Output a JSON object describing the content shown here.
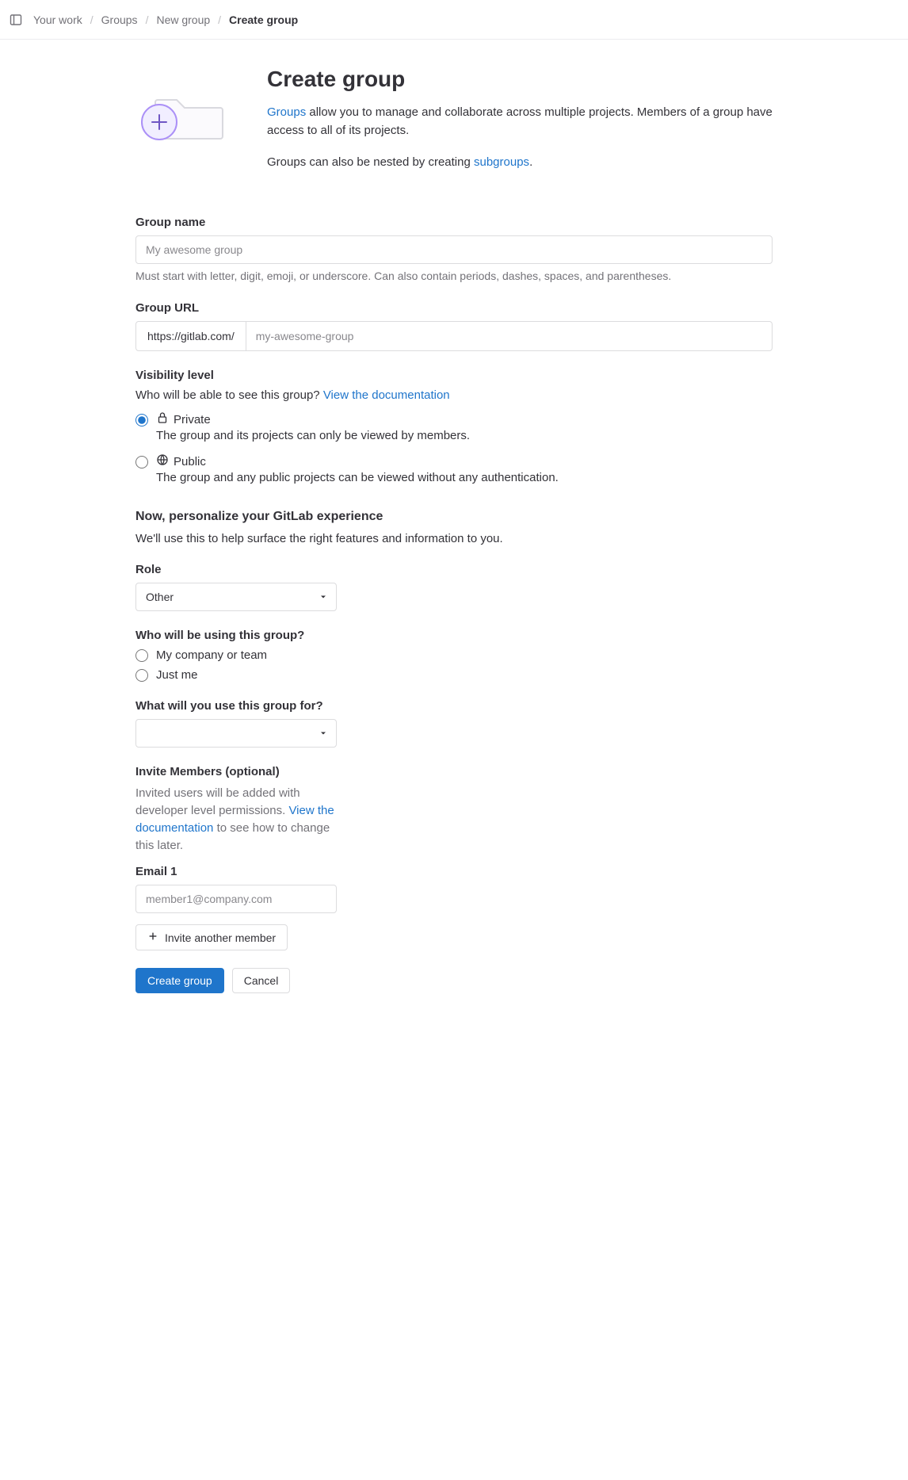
{
  "breadcrumbs": {
    "items": [
      "Your work",
      "Groups",
      "New group",
      "Create group"
    ]
  },
  "header": {
    "title": "Create group",
    "intro_prefix": "Groups",
    "intro_rest": " allow you to manage and collaborate across multiple projects. Members of a group have access to all of its projects.",
    "intro2_prefix": "Groups can also be nested by creating ",
    "intro2_link": "subgroups",
    "intro2_suffix": "."
  },
  "group_name": {
    "label": "Group name",
    "placeholder": "My awesome group",
    "helper": "Must start with letter, digit, emoji, or underscore. Can also contain periods, dashes, spaces, and parentheses."
  },
  "group_url": {
    "label": "Group URL",
    "prefix": "https://gitlab.com/",
    "placeholder": "my-awesome-group"
  },
  "visibility": {
    "label": "Visibility level",
    "question": "Who will be able to see this group? ",
    "doc_link": "View the documentation",
    "options": [
      {
        "value": "private",
        "title": "Private",
        "desc": "The group and its projects can only be viewed by members.",
        "selected": true
      },
      {
        "value": "public",
        "title": "Public",
        "desc": "The group and any public projects can be viewed without any authentication.",
        "selected": false
      }
    ]
  },
  "personalize": {
    "heading": "Now, personalize your GitLab experience",
    "sub": "We'll use this to help surface the right features and information to you."
  },
  "role": {
    "label": "Role",
    "selected": "Other"
  },
  "who": {
    "label": "Who will be using this group?",
    "options": [
      "My company or team",
      "Just me"
    ]
  },
  "usage": {
    "label": "What will you use this group for?",
    "selected": ""
  },
  "invite": {
    "heading": "Invite Members (optional)",
    "helper_pre": "Invited users will be added with developer level permissions. ",
    "helper_link": "View the documentation",
    "helper_post": " to see how to change this later.",
    "email_label": "Email 1",
    "email_placeholder": "member1@company.com",
    "another": "Invite another member"
  },
  "footer": {
    "submit": "Create group",
    "cancel": "Cancel"
  }
}
